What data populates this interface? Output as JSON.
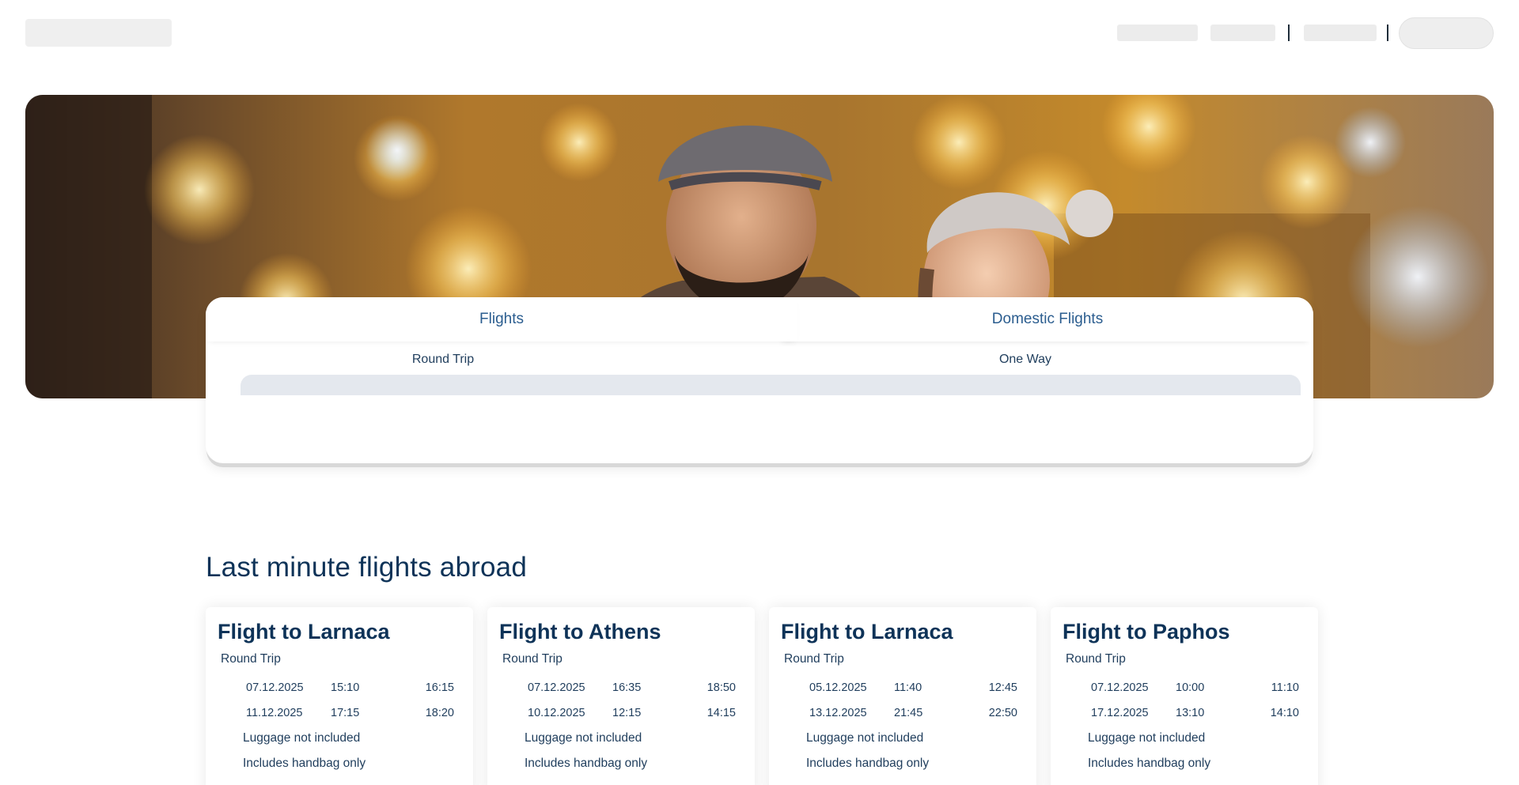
{
  "search": {
    "tabs": [
      {
        "label": "Flights"
      },
      {
        "label": "Domestic Flights"
      }
    ],
    "trip_types": [
      {
        "label": "Round Trip"
      },
      {
        "label": "One Way"
      }
    ]
  },
  "section": {
    "title": "Last minute flights abroad"
  },
  "deals": [
    {
      "title": "Flight to Larnaca",
      "trip_type": "Round Trip",
      "outbound": {
        "date": "07.12.2025",
        "departure": "15:10",
        "arrival": "16:15"
      },
      "return": {
        "date": "11.12.2025",
        "departure": "17:15",
        "arrival": "18:20"
      },
      "luggage": "Luggage not included",
      "handbag": "Includes handbag only"
    },
    {
      "title": "Flight to Athens",
      "trip_type": "Round Trip",
      "outbound": {
        "date": "07.12.2025",
        "departure": "16:35",
        "arrival": "18:50"
      },
      "return": {
        "date": "10.12.2025",
        "departure": "12:15",
        "arrival": "14:15"
      },
      "luggage": "Luggage not included",
      "handbag": "Includes handbag only"
    },
    {
      "title": "Flight to Larnaca",
      "trip_type": "Round Trip",
      "outbound": {
        "date": "05.12.2025",
        "departure": "11:40",
        "arrival": "12:45"
      },
      "return": {
        "date": "13.12.2025",
        "departure": "21:45",
        "arrival": "22:50"
      },
      "luggage": "Luggage not included",
      "handbag": "Includes handbag only"
    },
    {
      "title": "Flight to Paphos",
      "trip_type": "Round Trip",
      "outbound": {
        "date": "07.12.2025",
        "departure": "10:00",
        "arrival": "11:10"
      },
      "return": {
        "date": "17.12.2025",
        "departure": "13:10",
        "arrival": "14:10"
      },
      "luggage": "Luggage not included",
      "handbag": "Includes handbag only"
    }
  ]
}
